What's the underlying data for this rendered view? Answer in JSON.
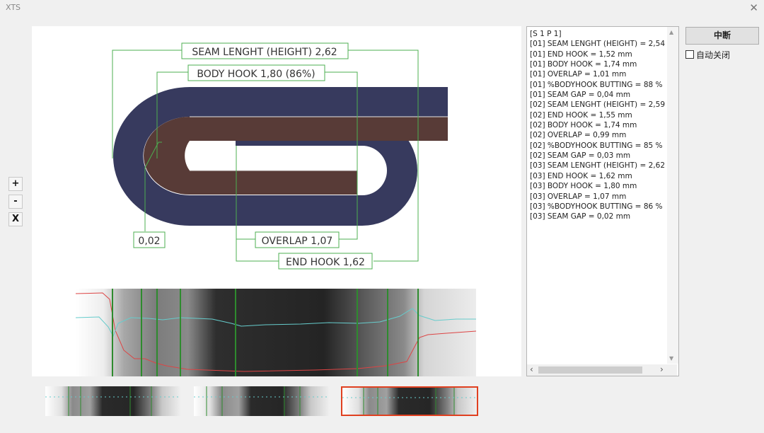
{
  "window": {
    "title": "XTS",
    "close_glyph": "✕"
  },
  "diagram": {
    "labels": {
      "seam_length": "SEAM LENGHT (HEIGHT) 2,62",
      "body_hook": "BODY HOOK 1,80 (86%)",
      "seam_gap": "0,02",
      "overlap": "OVERLAP 1,07",
      "end_hook": "END HOOK 1,62"
    },
    "colors": {
      "end_layer": "#373a5e",
      "body_layer": "#583b37",
      "leader": "#4caf50",
      "background": "#ffffff"
    }
  },
  "zoom": {
    "in": "+",
    "out": "-",
    "reset": "X"
  },
  "measurement_log": {
    "lines": [
      "[S 1 P 1]",
      "[01] SEAM LENGHT (HEIGHT) = 2,54",
      "[01] END HOOK = 1,52 mm",
      "[01] BODY HOOK = 1,74 mm",
      "[01] OVERLAP = 1,01 mm",
      "[01] %BODYHOOK BUTTING = 88 %",
      "[01] SEAM GAP = 0,04 mm",
      "[02] SEAM LENGHT (HEIGHT) = 2,59",
      "[02] END HOOK = 1,55 mm",
      "[02] BODY HOOK = 1,74 mm",
      "[02] OVERLAP = 0,99 mm",
      "[02] %BODYHOOK BUTTING = 85 %",
      "[02] SEAM GAP = 0,03 mm",
      "[03] SEAM LENGHT (HEIGHT) = 2,62",
      "[03] END HOOK = 1,62 mm",
      "[03] BODY HOOK = 1,80 mm",
      "[03] OVERLAP = 1,07 mm",
      "[03] %BODYHOOK BUTTING = 86 %",
      "[03] SEAM GAP = 0,02 mm"
    ]
  },
  "controls": {
    "stop_label": "中断",
    "auto_close_label": "自动关闭",
    "auto_close_checked": false
  },
  "thumbnails": [
    {
      "name": "capture-1",
      "selected": false
    },
    {
      "name": "capture-2",
      "selected": false
    },
    {
      "name": "capture-3",
      "selected": true
    }
  ]
}
